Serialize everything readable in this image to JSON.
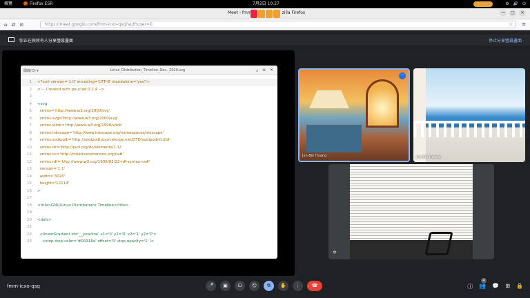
{
  "system_bar": {
    "activities": "概覽",
    "app": "Firefox ESR",
    "clock": "7月2日 10:27",
    "tray": [
      "⚙",
      "🔊",
      "⏻"
    ]
  },
  "window": {
    "title": "Meet - fmm-icxo-qsq — Mozilla Firefox",
    "title_left": "Meet - fmm",
    "title_right": "zilla Firefox",
    "controls": [
      "—",
      "□",
      "✕"
    ]
  },
  "nav": {
    "url": "https://meet.google.com/fmm-icxo-qsq?authuser=0",
    "icons": [
      "⌂",
      "⇄",
      "⊘"
    ],
    "star": "☆",
    "menu": "≡"
  },
  "share_banner": {
    "text": "你正在與所有人分享螢幕畫面",
    "stop": "停止分享螢幕畫面"
  },
  "editor": {
    "open_label": "開啟(O) ▾",
    "file_name": "Linux_Distribution_Timeline_Dec._2020.svg",
    "lines": [
      {
        "n": "1",
        "t": "<?xml version='1.0' encoding='UTF-8' standalone='yes'?>"
      },
      {
        "n": "2",
        "t": "<!-- Created with gnuclad 0.2.4 -->"
      },
      {
        "n": "3",
        "t": ""
      },
      {
        "n": "4",
        "t": "<svg"
      },
      {
        "n": "5",
        "t": "  xmlns='http://www.w3.org/2000/svg'"
      },
      {
        "n": "6",
        "t": "  xmlns:svg='http://www.w3.org/2000/svg'"
      },
      {
        "n": "7",
        "t": "  xmlns:xlink='http://www.w3.org/1999/xlink'"
      },
      {
        "n": "8",
        "t": "  xmlns:inkscape='http://www.inkscape.org/namespaces/inkscape'"
      },
      {
        "n": "9",
        "t": "  xmlns:sodipodi='http://sodipodi.sourceforge.net/DTD/sodipodi-0.dtd'"
      },
      {
        "n": "10",
        "t": "  xmlns:dc='http://purl.org/dc/elements/1.1/'"
      },
      {
        "n": "11",
        "t": "  xmlns:cc='http://creativecommons.org/ns#'"
      },
      {
        "n": "12",
        "t": "  xmlns:rdf='http://www.w3.org/1999/02/22-rdf-syntax-ns#'"
      },
      {
        "n": "13",
        "t": "  version='1.1'"
      },
      {
        "n": "14",
        "t": "  width='3020'"
      },
      {
        "n": "15",
        "t": "  height='12114'"
      },
      {
        "n": "16",
        "t": ">"
      },
      {
        "n": "17",
        "t": ""
      },
      {
        "n": "18",
        "t": "<title>GNU/Linux Distributions Timeline</title>"
      },
      {
        "n": "19",
        "t": ""
      },
      {
        "n": "20",
        "t": "<defs>"
      },
      {
        "n": "21",
        "t": ""
      },
      {
        "n": "22",
        "t": "  <linearGradient id='__yearline' x1='0' y1='0' x2='1' y2='0'>"
      },
      {
        "n": "23",
        "t": "    <stop stop-color='#00316e' offset='0' stop-opacity='1' />"
      }
    ]
  },
  "participants": [
    {
      "name": "Jen-Bin Huang"
    },
    {
      "name": "Jen-Bin Huang"
    }
  ],
  "meeting_code": "fmm-icxo-qsq",
  "controls": [
    "🎤",
    "▣",
    "⊡",
    "☺",
    "⧉",
    "✋",
    "⋮",
    "☎"
  ],
  "right_controls": [
    "ⓘ",
    "👥",
    "💬",
    "⊞",
    "🔒"
  ],
  "people_count": "4",
  "colors": {
    "accent": "#8ab4f8",
    "hangup": "#ea4335",
    "background": "#202124"
  }
}
